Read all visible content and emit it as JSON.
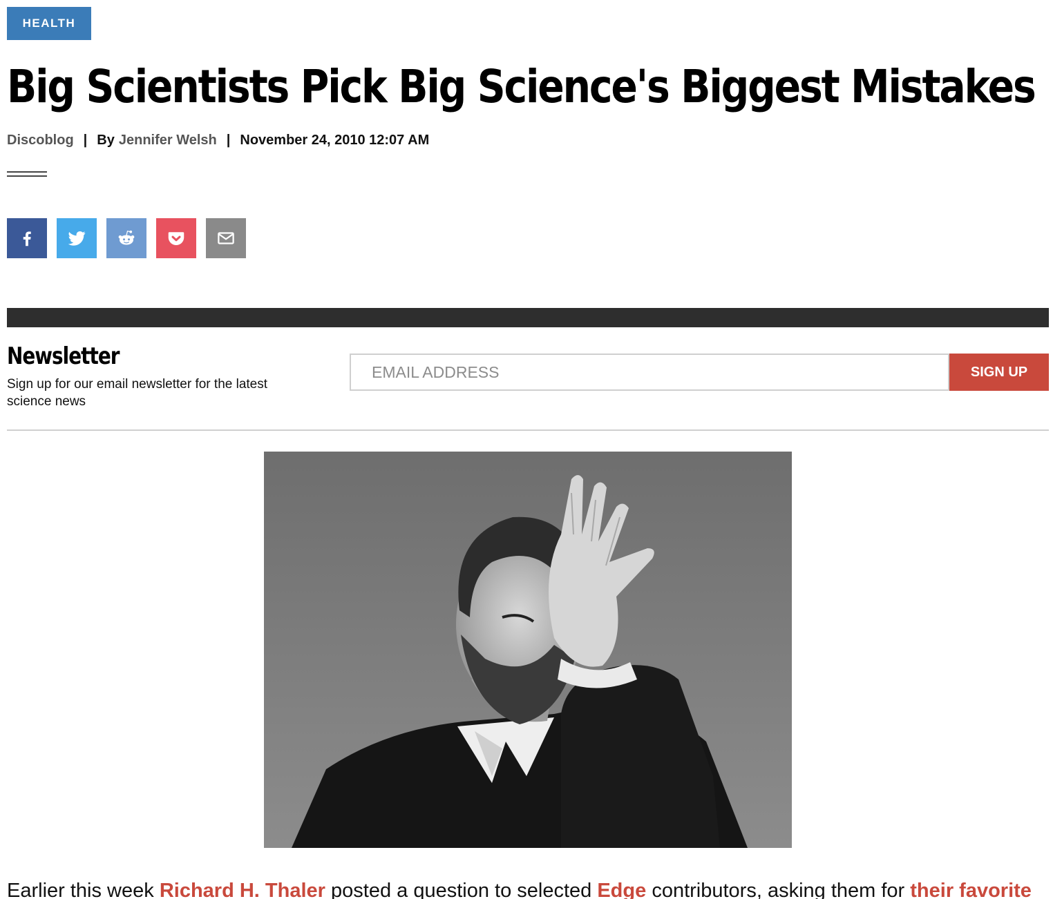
{
  "category": {
    "label": "HEALTH"
  },
  "article": {
    "title": "Big Scientists Pick Big Science's Biggest Mistakes",
    "blog": "Discoblog",
    "by_prefix": "By",
    "author": "Jennifer Welsh",
    "date": "November 24, 2010 12:07 AM",
    "separator": "|"
  },
  "share": {
    "facebook_icon": "facebook-icon",
    "twitter_icon": "twitter-icon",
    "reddit_icon": "reddit-icon",
    "pocket_icon": "pocket-icon",
    "email_icon": "email-icon"
  },
  "newsletter": {
    "title": "Newsletter",
    "description": "Sign up for our email newsletter for the latest science news",
    "email_placeholder": "EMAIL ADDRESS",
    "signup_label": "SIGN UP"
  },
  "body": {
    "p1_t1": "Earlier this week",
    "p1_link1": "Richard H. Thaler",
    "p1_t2": "posted a question to selected",
    "p1_link2": "Edge",
    "p1_t3": "contributors, asking them for",
    "p1_link3": "their favorite"
  },
  "colors": {
    "tag_blue": "#3b7cb8",
    "accent_red": "#c9493c",
    "facebook": "#3b5998",
    "twitter": "#47aaea",
    "reddit": "#6f9bd1",
    "pocket": "#e8525f",
    "email": "#8a8a8a"
  }
}
